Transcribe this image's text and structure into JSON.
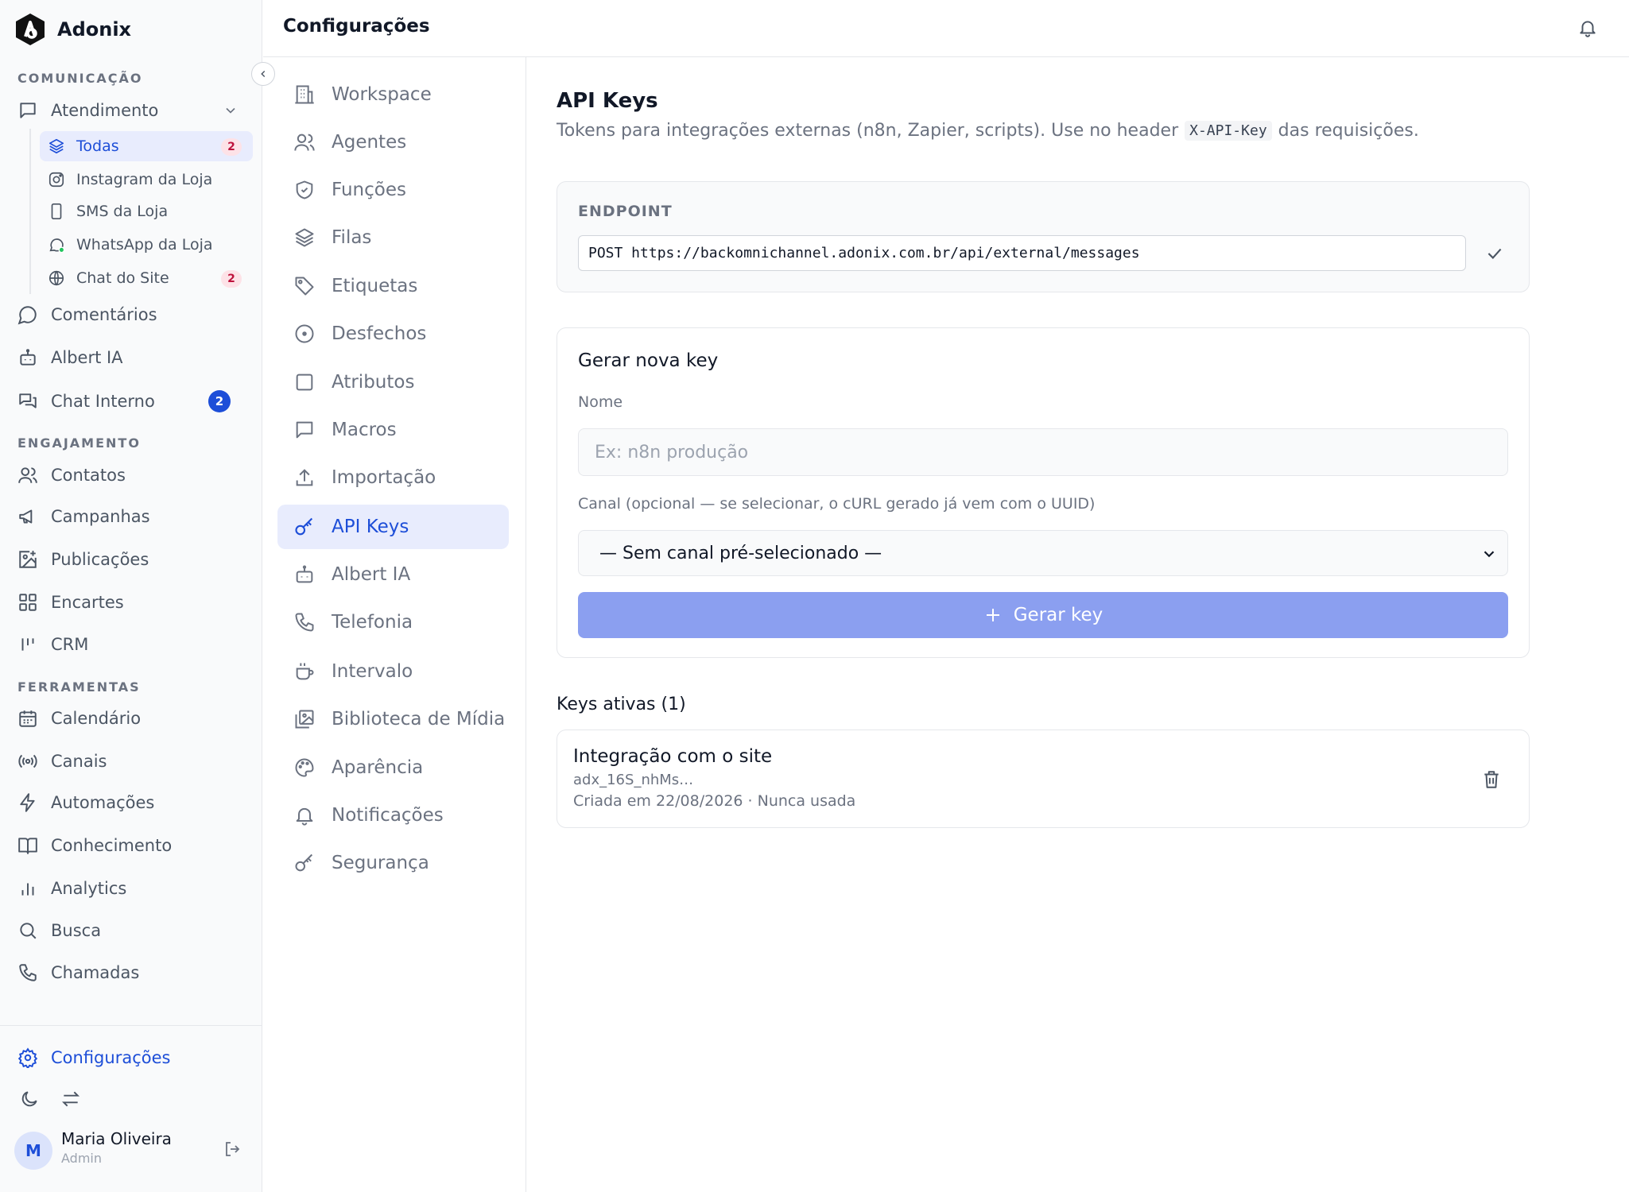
{
  "brand": {
    "name": "Adonix"
  },
  "sidebar": {
    "sections": {
      "communication": "COMUNICAÇÃO",
      "engagement": "ENGAJAMENTO",
      "tools": "FERRAMENTAS"
    },
    "atendimento": {
      "label": "Atendimento",
      "children": [
        {
          "label": "Todas",
          "badge": "2",
          "icon": "layers-icon",
          "active": true
        },
        {
          "label": "Instagram da Loja",
          "icon": "instagram-icon"
        },
        {
          "label": "SMS da Loja",
          "icon": "phone-icon"
        },
        {
          "label": "WhatsApp da Loja",
          "icon": "whatsapp-icon"
        },
        {
          "label": "Chat do Site",
          "badge": "2",
          "icon": "globe-icon"
        }
      ]
    },
    "communication_items": [
      {
        "label": "Comentários",
        "icon": "comment-icon"
      },
      {
        "label": "Albert IA",
        "icon": "bot-icon"
      },
      {
        "label": "Chat Interno",
        "icon": "chat-icon",
        "badge": "2"
      }
    ],
    "engagement_items": [
      {
        "label": "Contatos",
        "icon": "users-icon"
      },
      {
        "label": "Campanhas",
        "icon": "megaphone-icon"
      },
      {
        "label": "Publicações",
        "icon": "image-plus-icon"
      },
      {
        "label": "Encartes",
        "icon": "grid-icon"
      },
      {
        "label": "CRM",
        "icon": "kanban-icon"
      }
    ],
    "tools_items": [
      {
        "label": "Calendário",
        "icon": "calendar-icon"
      },
      {
        "label": "Canais",
        "icon": "radio-icon"
      },
      {
        "label": "Automações",
        "icon": "zap-icon"
      },
      {
        "label": "Conhecimento",
        "icon": "book-icon"
      },
      {
        "label": "Analytics",
        "icon": "bar-chart-icon"
      },
      {
        "label": "Busca",
        "icon": "search-icon"
      },
      {
        "label": "Chamadas",
        "icon": "phone-call-icon"
      }
    ],
    "settings_label": "Configurações",
    "user": {
      "initial": "M",
      "name": "Maria Oliveira",
      "role": "Admin"
    }
  },
  "header": {
    "title": "Configurações"
  },
  "settings_nav": [
    {
      "label": "Workspace",
      "icon": "building-icon"
    },
    {
      "label": "Agentes",
      "icon": "users-icon"
    },
    {
      "label": "Funções",
      "icon": "shield-icon"
    },
    {
      "label": "Filas",
      "icon": "layers-icon"
    },
    {
      "label": "Etiquetas",
      "icon": "tag-icon"
    },
    {
      "label": "Desfechos",
      "icon": "circle-dot-icon"
    },
    {
      "label": "Atributos",
      "icon": "square-icon"
    },
    {
      "label": "Macros",
      "icon": "message-square-icon"
    },
    {
      "label": "Importação",
      "icon": "upload-icon"
    },
    {
      "label": "API Keys",
      "icon": "key-icon",
      "active": true
    },
    {
      "label": "Albert IA",
      "icon": "bot-icon"
    },
    {
      "label": "Telefonia",
      "icon": "phone-icon"
    },
    {
      "label": "Intervalo",
      "icon": "coffee-icon"
    },
    {
      "label": "Biblioteca de Mídia",
      "icon": "images-icon"
    },
    {
      "label": "Aparência",
      "icon": "palette-icon"
    },
    {
      "label": "Notificações",
      "icon": "bell-icon"
    },
    {
      "label": "Segurança",
      "icon": "key-icon"
    }
  ],
  "main": {
    "title": "API Keys",
    "subtitle_before": "Tokens para integrações externas (n8n, Zapier, scripts). Use no header",
    "subtitle_code": "X-API-Key",
    "subtitle_after": "das requisições.",
    "endpoint": {
      "label": "ENDPOINT",
      "value": "POST https://backomnichannel.adonix.com.br/api/external/messages"
    },
    "generate": {
      "title": "Gerar nova key",
      "name_label": "Nome",
      "name_placeholder": "Ex: n8n produção",
      "channel_label": "Canal (opcional — se selecionar, o cURL gerado já vem com o UUID)",
      "channel_selected": "— Sem canal pré-selecionado —",
      "button_label": "Gerar key"
    },
    "keys": {
      "title": "Keys ativas (1)",
      "items": [
        {
          "name": "Integração com o site",
          "prefix": "adx_16S_nhMs…",
          "meta": "Criada em 22/08/2026 · Nunca usada"
        }
      ]
    }
  },
  "colors": {
    "accent": "#1d4ed8",
    "active_bg": "#e8ecfd",
    "button_bg": "#8b9ff0",
    "badge_pink_bg": "#fde2e7"
  }
}
